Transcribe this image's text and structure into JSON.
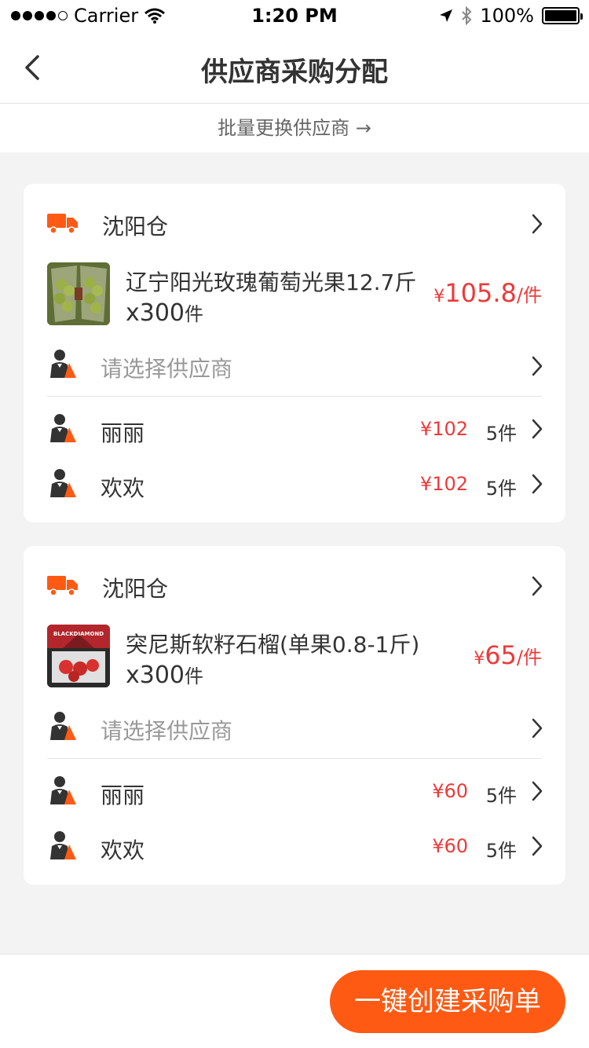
{
  "status_bar": {
    "carrier": "Carrier",
    "time": "1:20 PM",
    "battery": "100%"
  },
  "nav": {
    "title": "供应商采购分配"
  },
  "batch": {
    "label": "批量更换供应商 →"
  },
  "cards": [
    {
      "warehouse": "沈阳仓",
      "product": {
        "name": "辽宁阳光玫瑰葡萄光果12.7斤",
        "qty_prefix": "x300",
        "qty_unit": "件",
        "price_symbol": "¥",
        "price": "105.8",
        "price_unit": "/件"
      },
      "select_placeholder": "请选择供应商",
      "suppliers": [
        {
          "name": "丽丽",
          "price": "¥102",
          "qty": "5件"
        },
        {
          "name": "欢欢",
          "price": "¥102",
          "qty": "5件"
        }
      ]
    },
    {
      "warehouse": "沈阳仓",
      "product": {
        "name": "突尼斯软籽石榴(单果0.8-1斤)",
        "qty_prefix": "x300",
        "qty_unit": "件",
        "price_symbol": "¥",
        "price": "65",
        "price_unit": "/件",
        "thumb_text": "BLACKDIAMOND"
      },
      "select_placeholder": "请选择供应商",
      "suppliers": [
        {
          "name": "丽丽",
          "price": "¥60",
          "qty": "5件"
        },
        {
          "name": "欢欢",
          "price": "¥60",
          "qty": "5件"
        }
      ]
    }
  ],
  "bottom": {
    "create_label": "一键创建采购单"
  },
  "colors": {
    "accent": "#ff5a14",
    "price": "#ee3a3a",
    "background": "#f3f3f3"
  }
}
